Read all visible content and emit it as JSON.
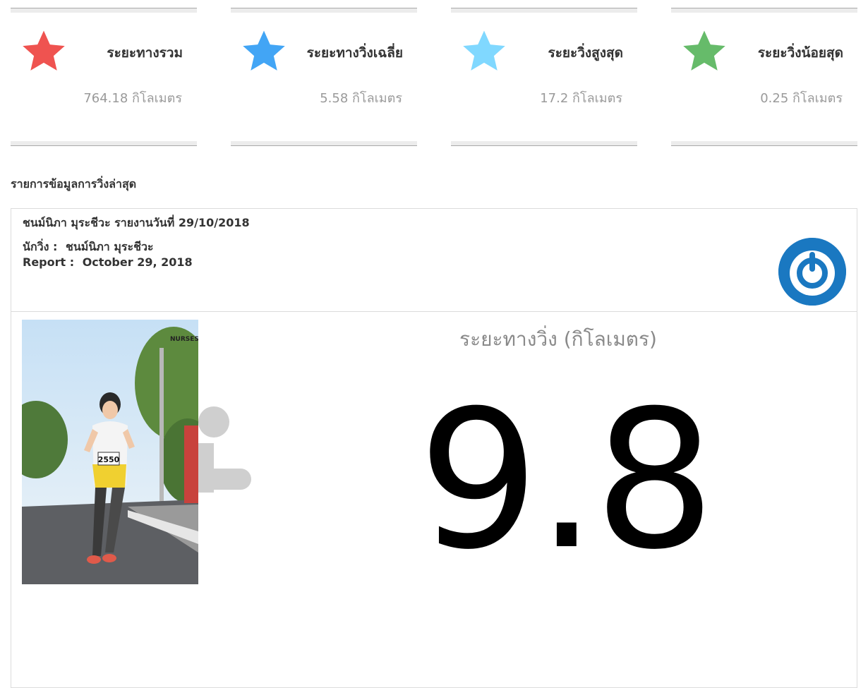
{
  "stats": [
    {
      "icon": "star-icon",
      "color": "#ef5350",
      "title": "ระยะทางรวม",
      "value": "764.18 กิโลเมตร"
    },
    {
      "icon": "star-icon",
      "color": "#42a5f5",
      "title": "ระยะทางวิ่งเฉลี่ย",
      "value": "5.58 กิโลเมตร"
    },
    {
      "icon": "star-icon",
      "color": "#80d8ff",
      "title": "ระยะวิ่งสูงสุด",
      "value": "17.2 กิโลเมตร"
    },
    {
      "icon": "star-icon",
      "color": "#66bb6a",
      "title": "ระยะวิ่งน้อยสุด",
      "value": "0.25 กิโลเมตร"
    }
  ],
  "section_title": "รายการข้อมูลการวิ่งล่าสุด",
  "report": {
    "heading": "ชนม์นิภา มุระชีวะ รายงานวันที่ 29/10/2018",
    "runner_label": "นักวิ่ง :",
    "runner_name": "ชนม์นิภา มุระชีวะ",
    "report_label": "Report :",
    "report_date": "October 29, 2018",
    "badge_icon": "power-icon",
    "badge_color": "#1a78c1",
    "photo_bib": "2550",
    "photo_logo": "NURSES RUN",
    "distance_label": "ระยะทางวิ่ง (กิโลเมตร)",
    "distance_value": "9.8"
  }
}
